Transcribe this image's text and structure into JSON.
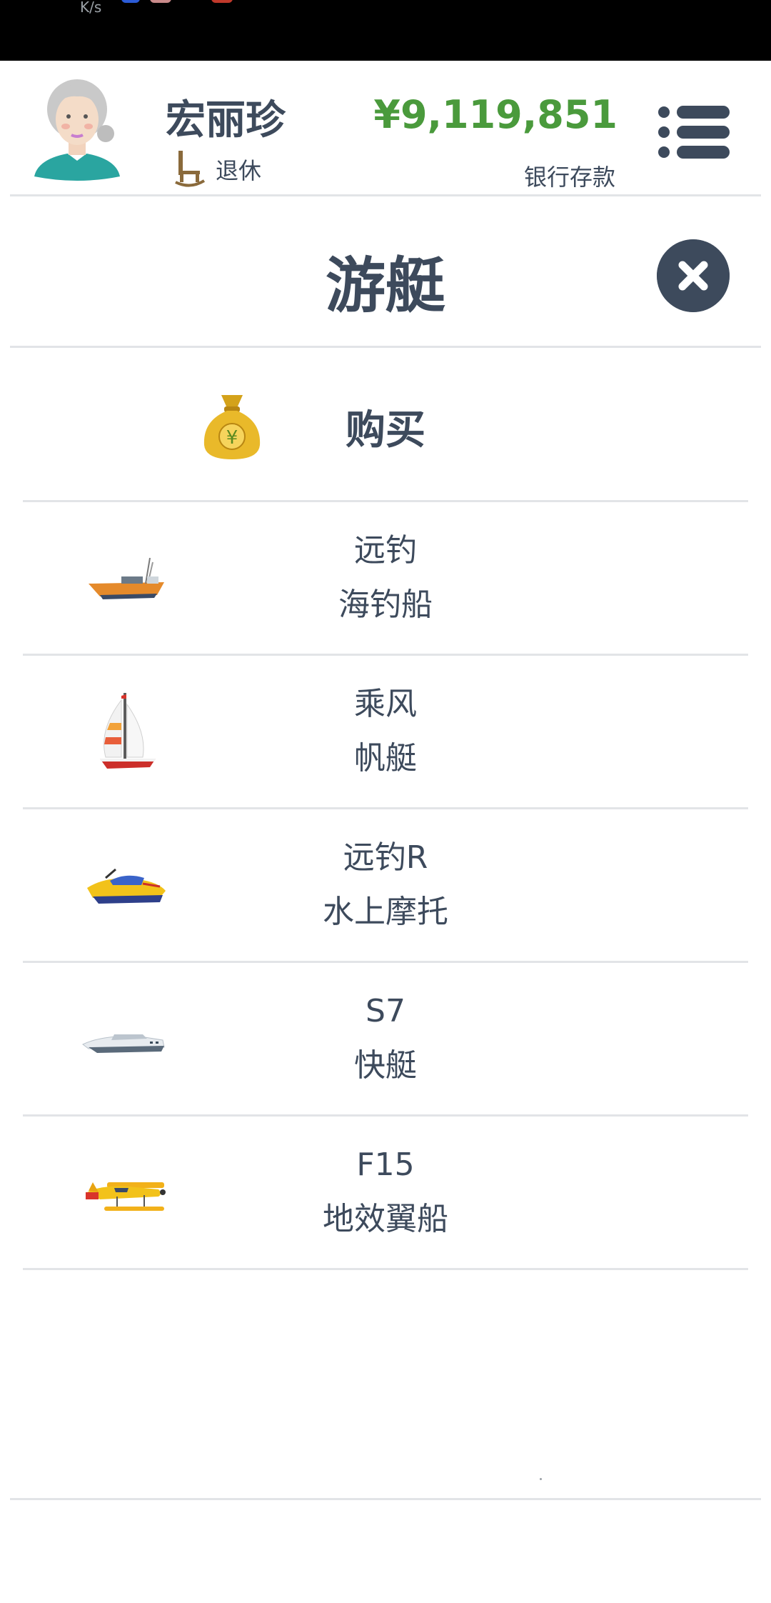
{
  "status_bar": {
    "net_speed_unit": "K/s"
  },
  "header": {
    "user_name": "宏丽珍",
    "status": "退休",
    "balance": "¥9,119,851",
    "balance_label": "银行存款",
    "avatar": "elderly-woman-avatar-icon",
    "status_icon": "rocking-chair-icon",
    "menu_icon": "menu-list-icon"
  },
  "page": {
    "title": "游艇",
    "close_icon": "close-icon"
  },
  "buy": {
    "label": "购买",
    "icon": "money-bag-icon"
  },
  "items": [
    {
      "line1": "远钓",
      "line2": "海钓船",
      "icon": "fishing-boat-icon"
    },
    {
      "line1": "乘风",
      "line2": "帆艇",
      "icon": "sailboat-icon"
    },
    {
      "line1": "远钓R",
      "line2": "水上摩托",
      "icon": "jet-ski-icon"
    },
    {
      "line1": "S7",
      "line2": "快艇",
      "icon": "speedboat-icon"
    },
    {
      "line1": "F15",
      "line2": "地效翼船",
      "icon": "seaplane-icon"
    }
  ],
  "colors": {
    "text": "#3d4a5c",
    "balance": "#4a9a3c",
    "divider": "#e2e4e7",
    "close_bg": "#3d4a5c"
  }
}
